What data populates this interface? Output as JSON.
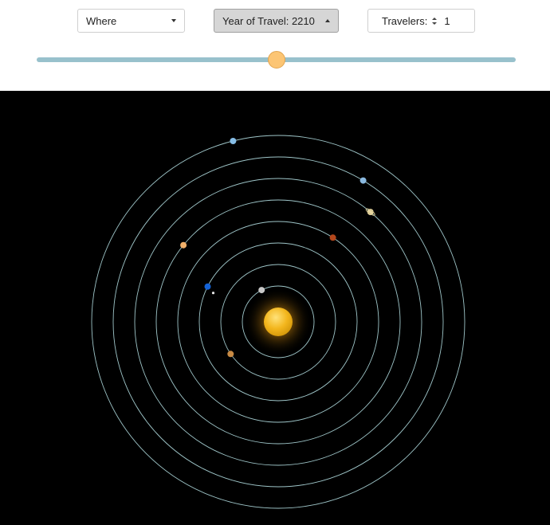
{
  "controls": {
    "where": {
      "label": "Where"
    },
    "year": {
      "label": "Year of Travel: 2210"
    },
    "travelers": {
      "label": "Travelers:",
      "value": "1"
    },
    "slider": {
      "fraction": 0.5
    }
  },
  "solar_system": {
    "sun_color": "#f3b61d",
    "orbit_color": "#9fc6c9",
    "planets": [
      {
        "name": "mercury",
        "orbit": 1,
        "angle_deg": 117.5,
        "color": "#c9c9c9"
      },
      {
        "name": "venus",
        "orbit": 2,
        "angle_deg": 214.0,
        "color": "#c88a44"
      },
      {
        "name": "earth",
        "orbit": 3,
        "angle_deg": 153.4,
        "color": "#1462d6",
        "moon_color": "#e6e6e6"
      },
      {
        "name": "mars",
        "orbit": 4,
        "angle_deg": 57.0,
        "color": "#b3461b"
      },
      {
        "name": "jupiter",
        "orbit": 5,
        "angle_deg": 141.0,
        "color": "#f0b06a"
      },
      {
        "name": "saturn",
        "orbit": 6,
        "angle_deg": 50.0,
        "color": "#e8d7a0"
      },
      {
        "name": "uranus",
        "orbit": 7,
        "angle_deg": 59.0,
        "color": "#8ab9e0"
      },
      {
        "name": "neptune",
        "orbit": 8,
        "angle_deg": 104.0,
        "color": "#86bde6"
      }
    ]
  }
}
